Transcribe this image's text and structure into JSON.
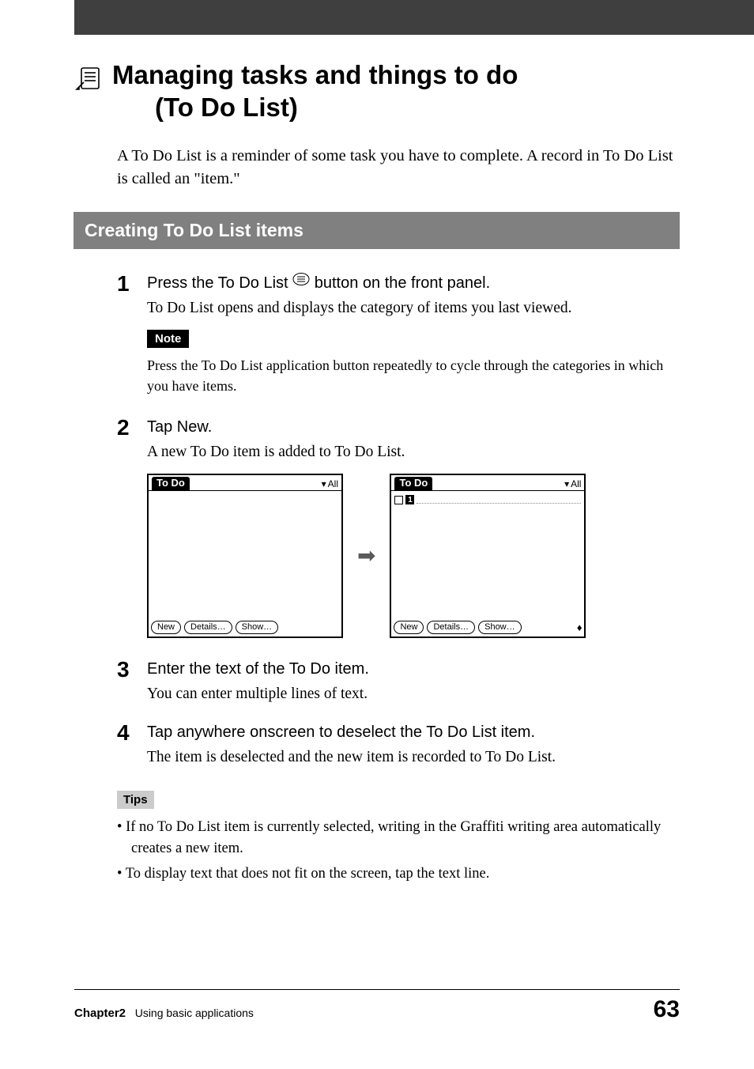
{
  "title": {
    "line1": "Managing tasks and things to do",
    "line2": "(To Do List)"
  },
  "intro": "A To Do List is a reminder of some task you have to complete. A record in To Do List is called an \"item.\"",
  "section_heading": "Creating To Do List items",
  "steps": {
    "s1": {
      "num": "1",
      "head_before": "Press the To Do List ",
      "head_after": " button on the front panel.",
      "desc": "To Do List opens and displays the category of items you last viewed.",
      "note_label": "Note",
      "note_text": "Press the To Do List application button repeatedly to cycle through the categories in which you have items."
    },
    "s2": {
      "num": "2",
      "head": "Tap New.",
      "desc": "A new To Do item is added to To Do List."
    },
    "s3": {
      "num": "3",
      "head": "Enter the text of the To Do item.",
      "desc": "You can enter multiple lines of text."
    },
    "s4": {
      "num": "4",
      "head": "Tap anywhere onscreen to deselect the To Do List item.",
      "desc": "The item is deselected and the new item is recorded to To Do List."
    }
  },
  "tips": {
    "label": "Tips",
    "items": [
      "If no To Do List item is currently selected, writing in the Graffiti writing area automatically creates a new item.",
      "To display text that does not fit on the screen, tap the text line."
    ]
  },
  "screenshots": {
    "app_title": "To Do",
    "category_label": "All",
    "priority": "1",
    "buttons": {
      "new": "New",
      "details": "Details…",
      "show": "Show…"
    }
  },
  "footer": {
    "chapter_label": "Chapter2",
    "chapter_title": "Using basic applications",
    "page": "63"
  }
}
